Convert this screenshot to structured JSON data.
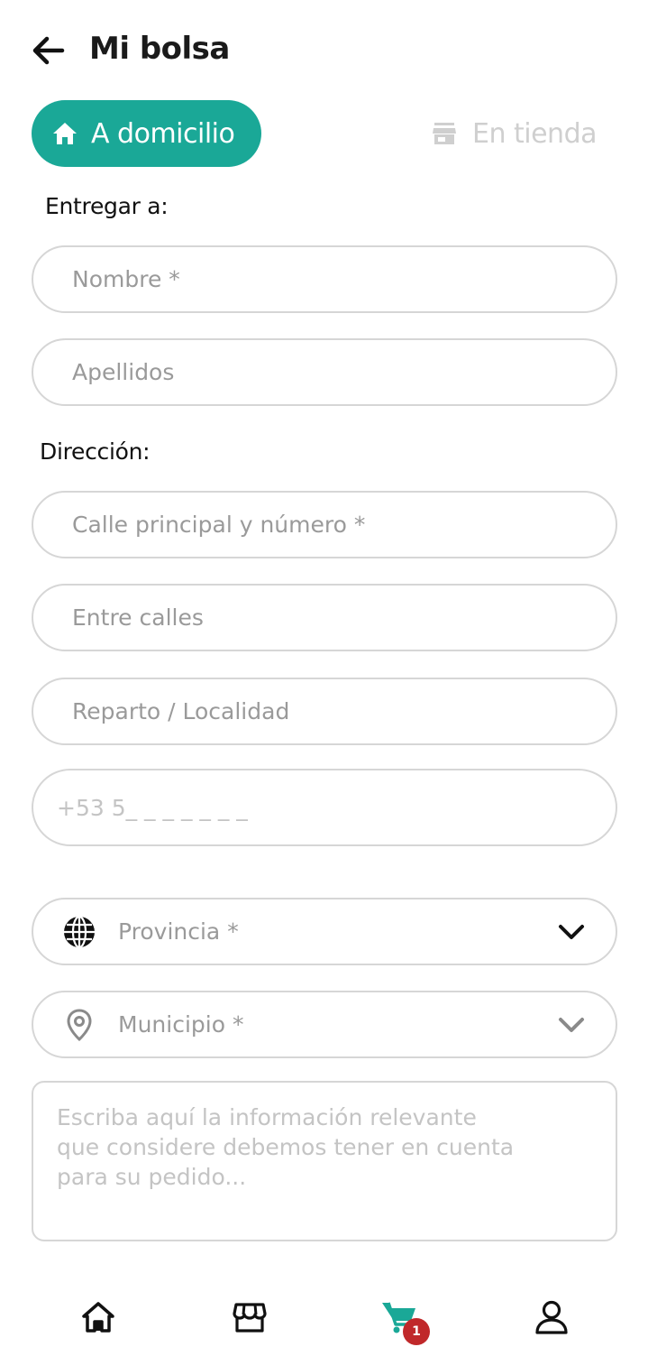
{
  "header": {
    "title": "Mi bolsa",
    "back_icon": "arrow-left-icon"
  },
  "delivery_toggle": {
    "home": {
      "label": "A domicilio",
      "icon": "home-icon",
      "active": true
    },
    "store": {
      "label": "En tienda",
      "icon": "store-icon",
      "active": false
    }
  },
  "colors": {
    "accent": "#1aa897",
    "badge": "#c0282a"
  },
  "recipient": {
    "section_label": "Entregar a:",
    "first_name_placeholder": "Nombre *",
    "last_name_placeholder": "Apellidos"
  },
  "address": {
    "section_label": "Dirección:",
    "street_placeholder": "Calle principal y número *",
    "between_streets_placeholder": "Entre calles",
    "locality_placeholder": "Reparto / Localidad",
    "phone_placeholder": "+53 5_ _ _ _ _ _ _",
    "province": {
      "value": "Provincia *",
      "icon": "globe-icon"
    },
    "municipality": {
      "value": "Municipio *",
      "icon": "location-pin-icon"
    },
    "notes_placeholder": "Escriba aquí la información relevante\nque considere debemos tener en cuenta\npara su pedido..."
  },
  "bottom_nav": {
    "items": [
      {
        "name": "home",
        "icon": "home-icon"
      },
      {
        "name": "stores",
        "icon": "store-icon"
      },
      {
        "name": "cart",
        "icon": "cart-icon",
        "active": true
      },
      {
        "name": "profile",
        "icon": "user-icon"
      }
    ],
    "cart_badge": "1"
  }
}
